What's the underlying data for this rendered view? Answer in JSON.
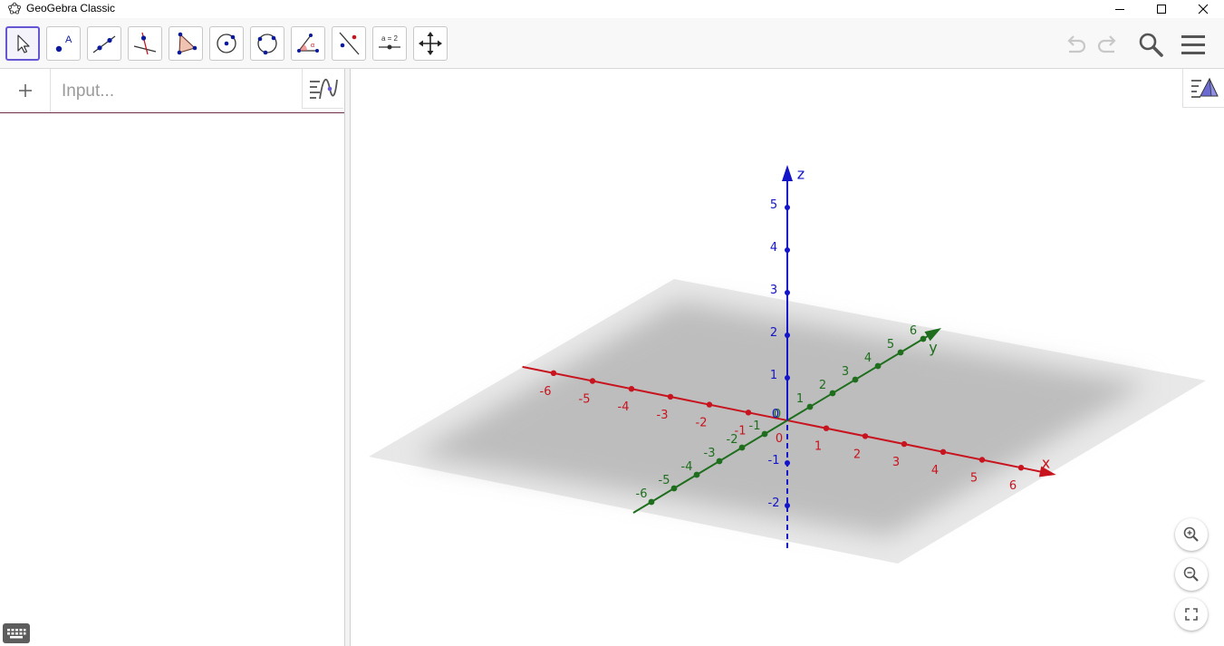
{
  "window": {
    "title": "GeoGebra Classic"
  },
  "toolbar": {
    "tools": [
      {
        "name": "move-tool",
        "icon": "arrow-cursor-icon",
        "selected": true
      },
      {
        "name": "point-tool",
        "icon": "point-icon"
      },
      {
        "name": "line-tool",
        "icon": "line-through-points-icon"
      },
      {
        "name": "perpendicular-line-tool",
        "icon": "perpendicular-line-icon"
      },
      {
        "name": "polygon-tool",
        "icon": "polygon-icon"
      },
      {
        "name": "circle-tool",
        "icon": "circle-center-point-icon"
      },
      {
        "name": "circle-three-points-tool",
        "icon": "circle-three-points-icon"
      },
      {
        "name": "angle-tool",
        "icon": "angle-icon"
      },
      {
        "name": "reflect-tool",
        "icon": "reflect-about-line-icon"
      },
      {
        "name": "slider-tool",
        "icon": "slider-icon",
        "label": "a = 2"
      },
      {
        "name": "move-graphics-view-tool",
        "icon": "move-arrows-icon"
      }
    ],
    "right": {
      "undo_icon": "undo-icon",
      "redo_icon": "redo-icon",
      "search_icon": "search-icon",
      "menu_icon": "hamburger-menu-icon"
    }
  },
  "algebra": {
    "add_icon": "+",
    "input_placeholder": "Input..."
  },
  "axes": {
    "x_label": "x",
    "y_label": "y",
    "z_label": "z",
    "x_ticks": [
      "-6",
      "-5",
      "-4",
      "-3",
      "-2",
      "-1",
      "0",
      "1",
      "2",
      "3",
      "4",
      "5",
      "6"
    ],
    "y_ticks": [
      "-6",
      "-5",
      "-4",
      "-3",
      "-2",
      "-1",
      "0",
      "1",
      "2",
      "3",
      "4",
      "5",
      "6"
    ],
    "z_ticks": [
      "-2",
      "-1",
      "0",
      "1",
      "2",
      "3",
      "4",
      "5"
    ],
    "colors": {
      "x": "#c8141e",
      "y": "#1e6e1e",
      "z": "#1414c8"
    }
  },
  "colors": {
    "accent": "#6557d2",
    "plane": "#b9b9b9",
    "input_underline": "#6e2e4a"
  }
}
